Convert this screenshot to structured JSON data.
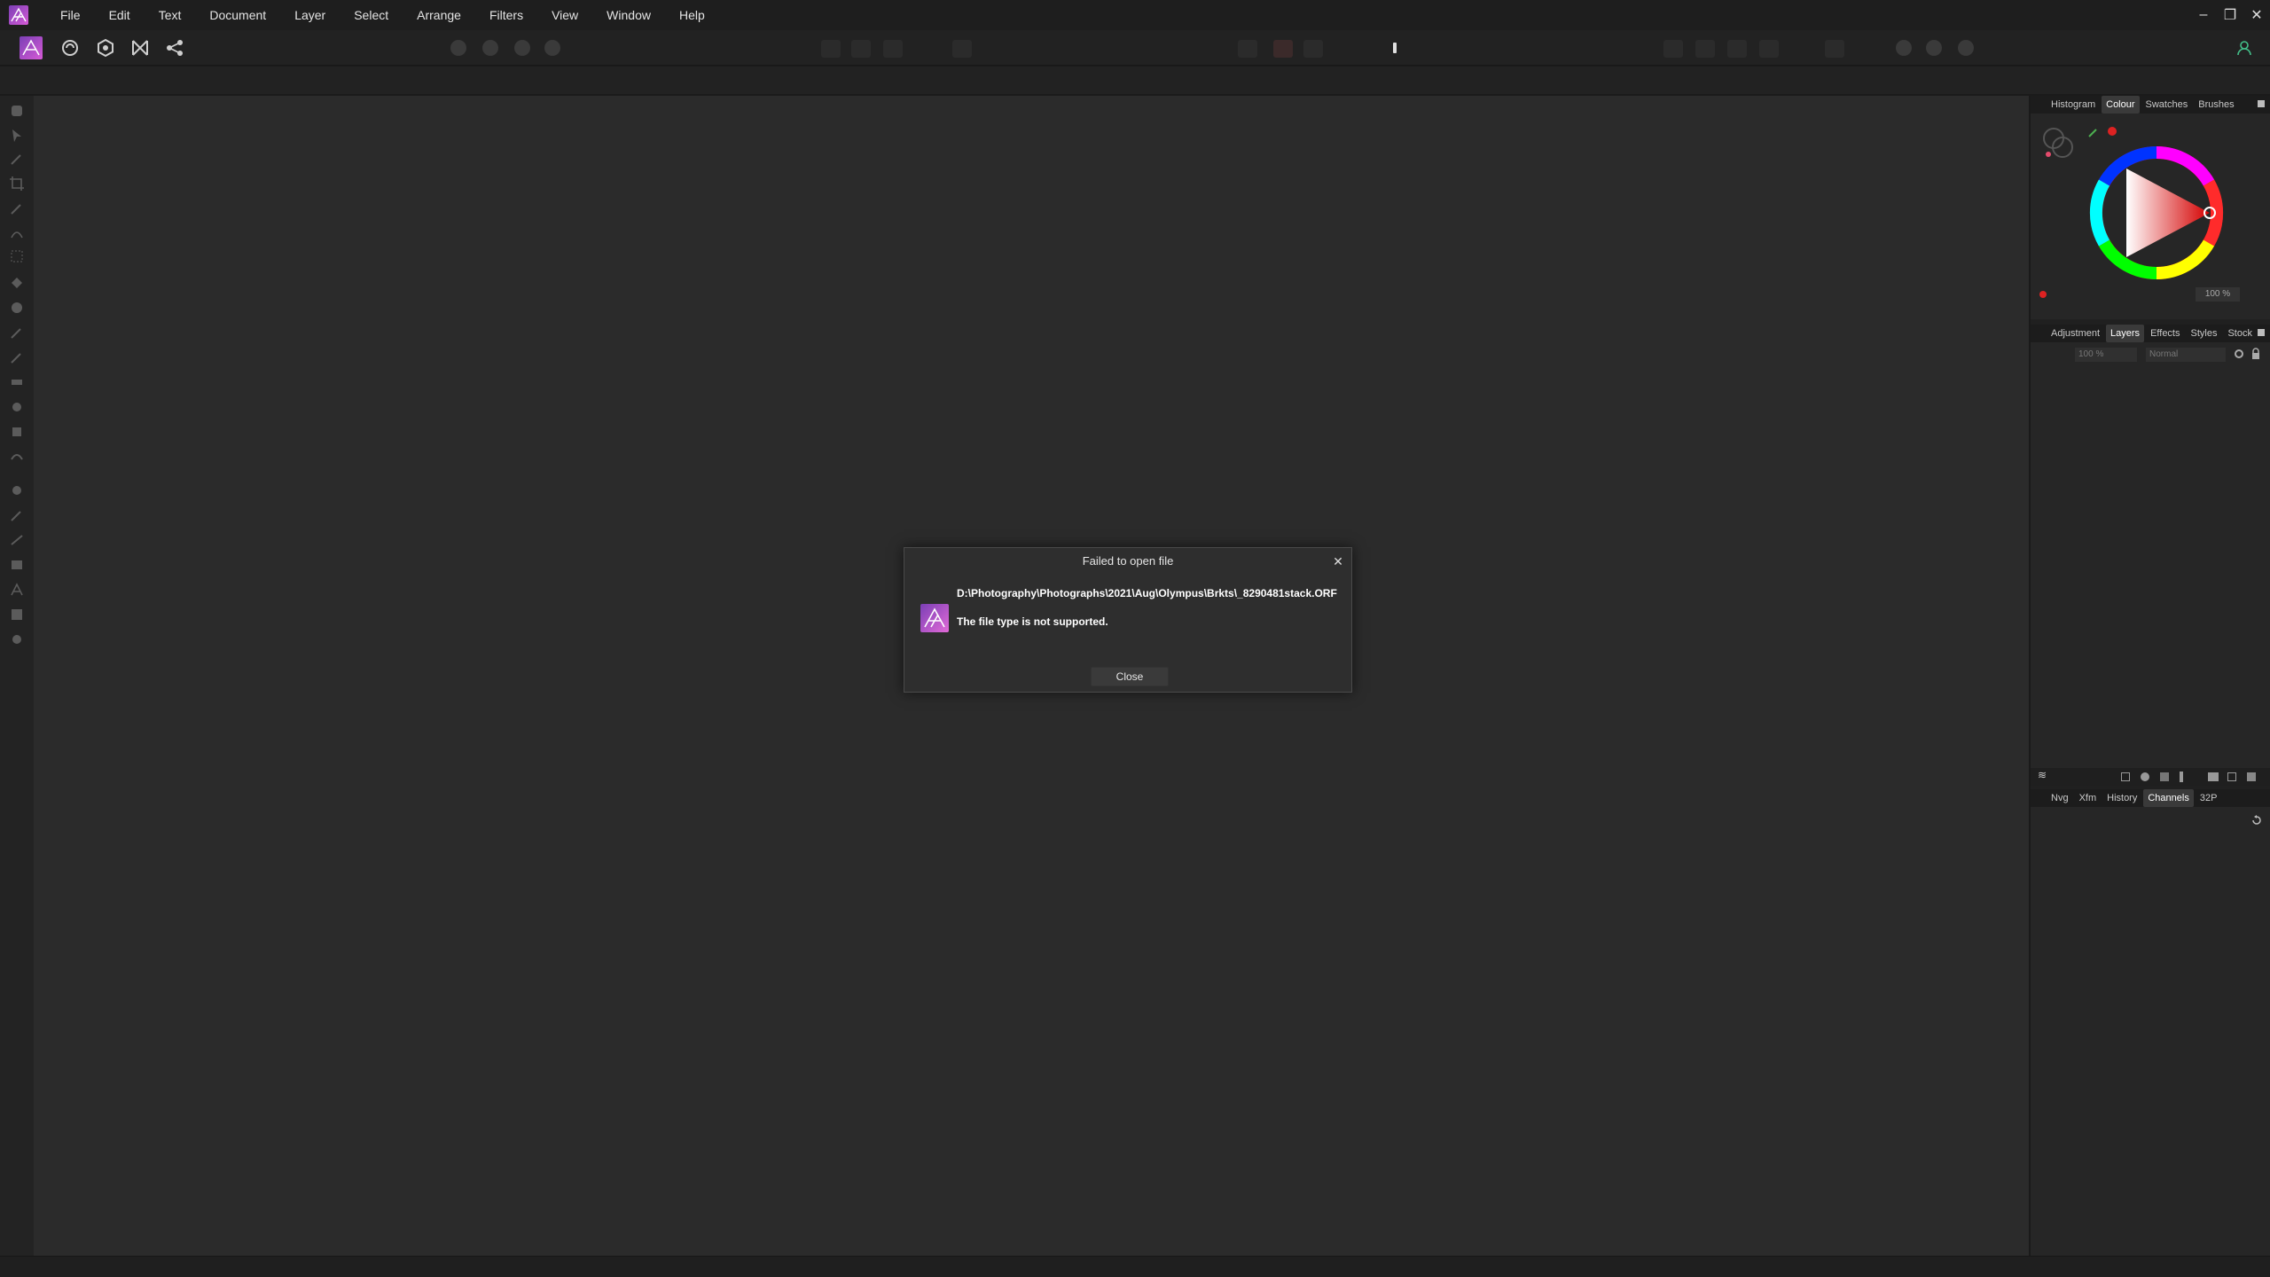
{
  "menubar": {
    "items": [
      "File",
      "Edit",
      "Text",
      "Document",
      "Layer",
      "Select",
      "Arrange",
      "Filters",
      "View",
      "Window",
      "Help"
    ]
  },
  "window_controls": {
    "minimize": "–",
    "restore": "❐",
    "close": "✕"
  },
  "colours": {
    "accent": "#c05ac8",
    "brand_gradient_start": "#7b3fb5",
    "brand_gradient_end": "#d65ad6"
  },
  "panels": {
    "top": {
      "tabs": [
        "Histogram",
        "Colour",
        "Swatches",
        "Brushes"
      ],
      "active": "Colour",
      "opacity_value": "100 %"
    },
    "middle": {
      "tabs": [
        "Adjustment",
        "Layers",
        "Effects",
        "Styles",
        "Stock"
      ],
      "active": "Layers",
      "opacity_value": "100 %",
      "blend_mode": "Normal"
    },
    "bottom": {
      "tabs": [
        "Nvg",
        "Xfm",
        "History",
        "Channels",
        "32P"
      ],
      "active": "Channels"
    }
  },
  "dialog": {
    "title": "Failed to open file",
    "path": "D:\\Photography\\Photographs\\2021\\Aug\\Olympus\\Brkts\\_8290481stack.ORF",
    "message": "The file type is not supported.",
    "close_label": "Close"
  }
}
